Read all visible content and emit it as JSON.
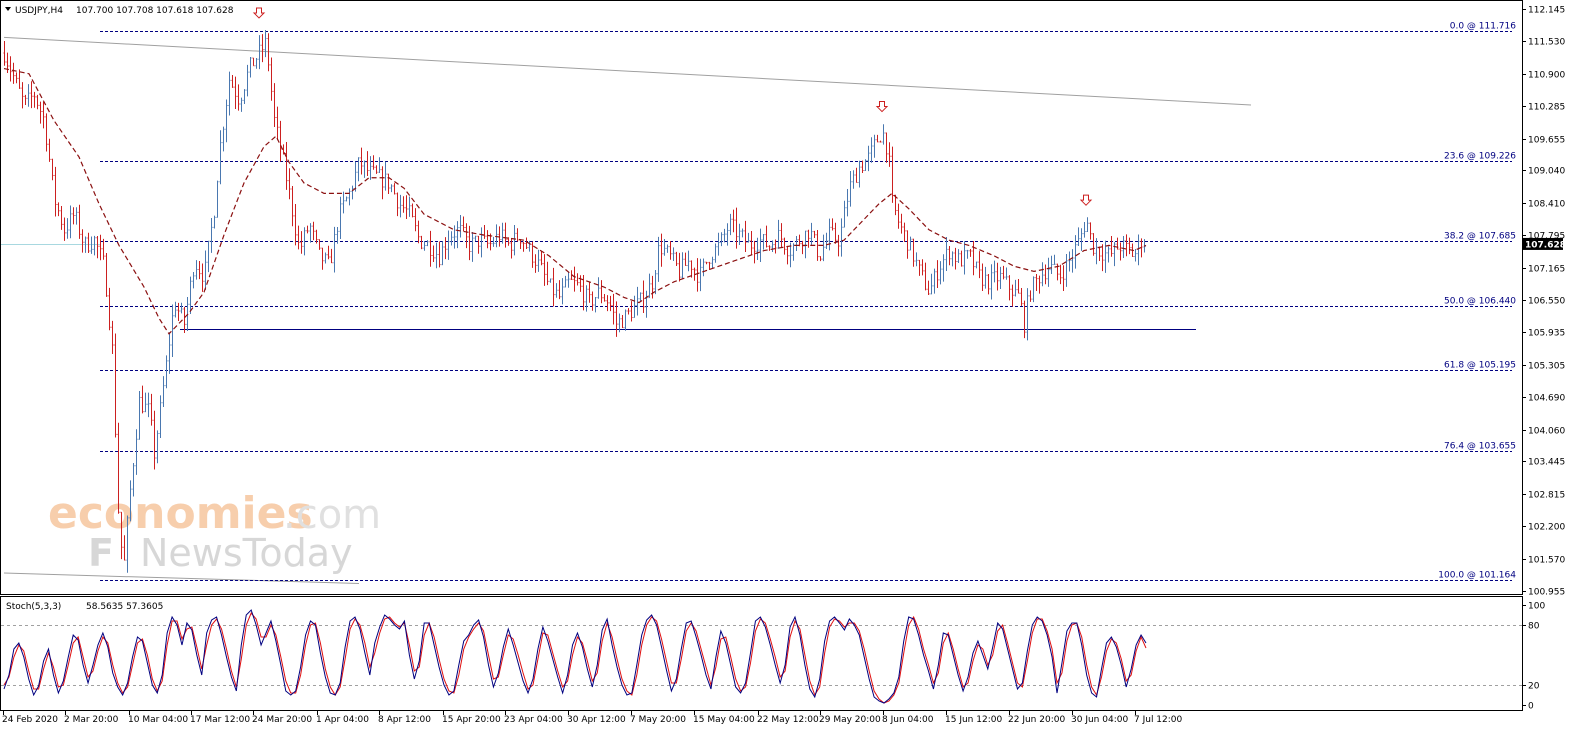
{
  "header": {
    "symbol_label": "USDJPY,H4",
    "ohlc_label": "107.700 107.708 107.618 107.628"
  },
  "sub_window": {
    "label": "Stoch(5,3,3)",
    "values_label": "58.5635 57.3605"
  },
  "watermark": {
    "line1_a": "economies",
    "line1_b": ".com",
    "line2_a": "F",
    "line2_b": "NewsToday"
  },
  "colors": {
    "bull": "#4a78b0",
    "bear": "#cc2020",
    "ma": "#8b1010",
    "fib": "#000080",
    "stoch_main": "#000080",
    "stoch_signal": "#e01010",
    "trend": "#a0a0a0",
    "current_price_box": "#000000"
  },
  "chart_data": [
    {
      "type": "candlestick",
      "title": "USDJPY,H4",
      "ylim": [
        100.955,
        112.145
      ],
      "y_ticks": [
        "112.145",
        "111.530",
        "110.900",
        "110.285",
        "109.655",
        "109.040",
        "108.410",
        "107.795",
        "107.165",
        "106.550",
        "105.935",
        "105.305",
        "104.690",
        "104.060",
        "103.445",
        "102.815",
        "102.200",
        "101.570",
        "100.955"
      ],
      "x_ticks": [
        "24 Feb 2020",
        "2 Mar 20:00",
        "10 Mar 04:00",
        "17 Mar 12:00",
        "24 Mar 20:00",
        "1 Apr 04:00",
        "8 Apr 12:00",
        "15 Apr 20:00",
        "23 Apr 04:00",
        "30 Apr 12:00",
        "7 May 20:00",
        "15 May 04:00",
        "22 May 12:00",
        "29 May 20:00",
        "8 Jun 04:00",
        "15 Jun 12:00",
        "22 Jun 20:00",
        "30 Jun 04:00",
        "7 Jul 12:00"
      ],
      "current_price": "107.628",
      "fibonacci": [
        {
          "label": "0.0 @ 111.716",
          "value": 111.716
        },
        {
          "label": "23.6 @ 109.226",
          "value": 109.226
        },
        {
          "label": "38.2 @ 107.685",
          "value": 107.685
        },
        {
          "label": "50.0 @ 106.440",
          "value": 106.44
        },
        {
          "label": "61.8 @ 105.195",
          "value": 105.195
        },
        {
          "label": "76.4 @ 103.655",
          "value": 103.655
        },
        {
          "label": "100.0 @ 101.164",
          "value": 101.164
        }
      ],
      "support_level": 106.0,
      "price_path": [
        [
          0,
          111.3
        ],
        [
          10,
          110.8
        ],
        [
          20,
          110.3
        ],
        [
          30,
          110.5
        ],
        [
          40,
          110.0
        ],
        [
          50,
          108.5
        ],
        [
          60,
          107.9
        ],
        [
          70,
          108.2
        ],
        [
          80,
          107.6
        ],
        [
          90,
          107.7
        ],
        [
          100,
          107.2
        ],
        [
          108,
          105.6
        ],
        [
          115,
          102.0
        ],
        [
          120,
          101.5
        ],
        [
          125,
          102.7
        ],
        [
          135,
          104.6
        ],
        [
          145,
          104.4
        ],
        [
          150,
          103.6
        ],
        [
          160,
          105.0
        ],
        [
          170,
          106.5
        ],
        [
          180,
          106.1
        ],
        [
          190,
          107.3
        ],
        [
          200,
          107.0
        ],
        [
          210,
          108.3
        ],
        [
          215,
          109.4
        ],
        [
          225,
          110.8
        ],
        [
          235,
          110.4
        ],
        [
          245,
          111.0
        ],
        [
          255,
          111.3
        ],
        [
          262,
          111.5
        ],
        [
          270,
          110.0
        ],
        [
          278,
          109.3
        ],
        [
          285,
          108.6
        ],
        [
          295,
          107.5
        ],
        [
          305,
          108.0
        ],
        [
          315,
          107.4
        ],
        [
          325,
          107.2
        ],
        [
          335,
          108.2
        ],
        [
          345,
          108.6
        ],
        [
          355,
          109.2
        ],
        [
          365,
          109.0
        ],
        [
          375,
          108.9
        ],
        [
          385,
          108.8
        ],
        [
          395,
          108.4
        ],
        [
          405,
          108.2
        ],
        [
          415,
          107.7
        ],
        [
          425,
          107.6
        ],
        [
          435,
          107.4
        ],
        [
          445,
          107.8
        ],
        [
          455,
          107.9
        ],
        [
          465,
          107.6
        ],
        [
          475,
          107.7
        ],
        [
          485,
          107.6
        ],
        [
          495,
          107.8
        ],
        [
          505,
          107.6
        ],
        [
          515,
          107.8
        ],
        [
          525,
          107.5
        ],
        [
          535,
          107.2
        ],
        [
          545,
          106.8
        ],
        [
          555,
          106.6
        ],
        [
          565,
          106.9
        ],
        [
          575,
          106.8
        ],
        [
          585,
          106.5
        ],
        [
          595,
          106.7
        ],
        [
          605,
          106.5
        ],
        [
          612,
          106.1
        ],
        [
          620,
          106.2
        ],
        [
          630,
          106.4
        ],
        [
          640,
          106.6
        ],
        [
          648,
          106.9
        ],
        [
          655,
          107.6
        ],
        [
          665,
          107.4
        ],
        [
          675,
          107.1
        ],
        [
          685,
          107.3
        ],
        [
          695,
          107.0
        ],
        [
          705,
          107.4
        ],
        [
          715,
          107.6
        ],
        [
          725,
          108.0
        ],
        [
          735,
          107.8
        ],
        [
          745,
          107.6
        ],
        [
          755,
          107.7
        ],
        [
          765,
          107.6
        ],
        [
          775,
          107.8
        ],
        [
          785,
          107.5
        ],
        [
          795,
          107.7
        ],
        [
          805,
          107.9
        ],
        [
          815,
          107.4
        ],
        [
          825,
          107.8
        ],
        [
          835,
          107.7
        ],
        [
          845,
          108.7
        ],
        [
          855,
          109.1
        ],
        [
          865,
          109.3
        ],
        [
          872,
          109.6
        ],
        [
          878,
          109.8
        ],
        [
          884,
          109.4
        ],
        [
          888,
          108.4
        ],
        [
          895,
          108.0
        ],
        [
          905,
          107.6
        ],
        [
          915,
          107.1
        ],
        [
          925,
          106.7
        ],
        [
          935,
          107.2
        ],
        [
          945,
          107.5
        ],
        [
          955,
          107.3
        ],
        [
          965,
          107.4
        ],
        [
          975,
          107.0
        ],
        [
          985,
          106.9
        ],
        [
          995,
          107.0
        ],
        [
          1005,
          106.8
        ],
        [
          1015,
          106.6
        ],
        [
          1020,
          106.1
        ],
        [
          1025,
          106.7
        ],
        [
          1035,
          107.0
        ],
        [
          1045,
          107.2
        ],
        [
          1055,
          107.0
        ],
        [
          1065,
          107.3
        ],
        [
          1075,
          107.7
        ],
        [
          1082,
          108.1
        ],
        [
          1088,
          107.6
        ],
        [
          1095,
          107.5
        ],
        [
          1105,
          107.4
        ],
        [
          1115,
          107.6
        ],
        [
          1125,
          107.5
        ],
        [
          1130,
          107.4
        ],
        [
          1137,
          107.7
        ],
        [
          1142,
          107.63
        ]
      ],
      "ma_path": [
        [
          0,
          111.0
        ],
        [
          25,
          110.9
        ],
        [
          50,
          110.0
        ],
        [
          75,
          109.3
        ],
        [
          95,
          108.4
        ],
        [
          115,
          107.6
        ],
        [
          140,
          106.8
        ],
        [
          155,
          106.2
        ],
        [
          165,
          105.9
        ],
        [
          185,
          106.3
        ],
        [
          200,
          106.7
        ],
        [
          220,
          107.8
        ],
        [
          240,
          108.8
        ],
        [
          260,
          109.5
        ],
        [
          272,
          109.7
        ],
        [
          285,
          109.2
        ],
        [
          300,
          108.8
        ],
        [
          320,
          108.6
        ],
        [
          345,
          108.6
        ],
        [
          365,
          108.9
        ],
        [
          385,
          108.9
        ],
        [
          400,
          108.7
        ],
        [
          420,
          108.2
        ],
        [
          450,
          107.9
        ],
        [
          480,
          107.8
        ],
        [
          520,
          107.7
        ],
        [
          545,
          107.4
        ],
        [
          570,
          107.0
        ],
        [
          600,
          106.8
        ],
        [
          620,
          106.6
        ],
        [
          635,
          106.5
        ],
        [
          650,
          106.7
        ],
        [
          670,
          106.9
        ],
        [
          700,
          107.1
        ],
        [
          730,
          107.3
        ],
        [
          760,
          107.5
        ],
        [
          790,
          107.6
        ],
        [
          820,
          107.6
        ],
        [
          840,
          107.7
        ],
        [
          860,
          108.1
        ],
        [
          875,
          108.4
        ],
        [
          888,
          108.6
        ],
        [
          905,
          108.3
        ],
        [
          925,
          107.9
        ],
        [
          945,
          107.7
        ],
        [
          965,
          107.6
        ],
        [
          990,
          107.4
        ],
        [
          1010,
          107.2
        ],
        [
          1030,
          107.1
        ],
        [
          1055,
          107.2
        ],
        [
          1080,
          107.5
        ],
        [
          1105,
          107.6
        ],
        [
          1130,
          107.5
        ],
        [
          1142,
          107.6
        ]
      ],
      "resistance_trendline": [
        [
          0,
          111.6
        ],
        [
          1247,
          110.3
        ]
      ],
      "support_trendline": [
        [
          0,
          101.3
        ],
        [
          355,
          101.1
        ]
      ],
      "peak_markers": [
        [
          255,
          112.05
        ],
        [
          878,
          110.25
        ],
        [
          1082,
          108.45
        ]
      ]
    },
    {
      "type": "line",
      "title": "Stoch(5,3,3)",
      "ylim": [
        0,
        100
      ],
      "y_ticks": [
        "100",
        "80",
        "20",
        "0"
      ],
      "levels": [
        80,
        20
      ],
      "main_last": 58.5635,
      "signal_last": 57.3605,
      "series": [
        {
          "values": [
            16,
            30,
            56,
            62,
            48,
            26,
            10,
            19,
            44,
            56,
            30,
            12,
            24,
            48,
            70,
            65,
            40,
            22,
            40,
            60,
            72,
            58,
            32,
            18,
            10,
            22,
            48,
            68,
            64,
            42,
            20,
            12,
            30,
            72,
            88,
            80,
            60,
            82,
            75,
            50,
            30,
            72,
            85,
            88,
            70,
            48,
            28,
            14,
            60,
            90,
            95,
            80,
            60,
            72,
            84,
            64,
            40,
            14,
            10,
            14,
            38,
            70,
            84,
            80,
            52,
            28,
            12,
            10,
            22,
            58,
            84,
            88,
            76,
            52,
            30,
            62,
            78,
            90,
            86,
            80,
            76,
            84,
            50,
            26,
            44,
            82,
            82,
            60,
            38,
            20,
            10,
            14,
            40,
            64,
            70,
            80,
            85,
            68,
            40,
            18,
            32,
            58,
            76,
            60,
            42,
            24,
            12,
            26,
            56,
            78,
            64,
            46,
            28,
            12,
            30,
            60,
            72,
            58,
            36,
            18,
            40,
            75,
            86,
            60,
            38,
            20,
            10,
            12,
            40,
            70,
            85,
            90,
            80,
            58,
            35,
            14,
            26,
            56,
            82,
            84,
            68,
            50,
            30,
            16,
            48,
            74,
            62,
            40,
            18,
            12,
            22,
            52,
            84,
            88,
            78,
            60,
            40,
            22,
            40,
            78,
            88,
            70,
            40,
            16,
            8,
            26,
            64,
            84,
            88,
            82,
            75,
            86,
            80,
            70,
            48,
            26,
            8,
            4,
            2,
            6,
            12,
            28,
            64,
            88,
            86,
            70,
            50,
            34,
            16,
            40,
            72,
            70,
            50,
            30,
            14,
            28,
            52,
            64,
            50,
            36,
            58,
            82,
            76,
            56,
            36,
            16,
            22,
            54,
            80,
            88,
            84,
            70,
            48,
            12,
            42,
            74,
            82,
            82,
            60,
            30,
            12,
            8,
            36,
            62,
            68,
            58,
            40,
            18,
            36,
            60,
            70,
            62
          ]
        },
        {
          "values": [
            20,
            28,
            48,
            60,
            54,
            34,
            16,
            16,
            36,
            52,
            38,
            18,
            20,
            40,
            62,
            68,
            48,
            28,
            34,
            54,
            68,
            62,
            40,
            22,
            12,
            18,
            40,
            62,
            66,
            50,
            26,
            14,
            24,
            60,
            84,
            84,
            66,
            76,
            78,
            58,
            36,
            60,
            80,
            86,
            76,
            56,
            34,
            18,
            46,
            80,
            92,
            86,
            68,
            68,
            80,
            70,
            48,
            24,
            12,
            12,
            30,
            60,
            80,
            82,
            62,
            36,
            18,
            10,
            18,
            46,
            76,
            86,
            80,
            62,
            38,
            52,
            72,
            86,
            88,
            82,
            78,
            82,
            60,
            34,
            38,
            70,
            82,
            68,
            46,
            26,
            14,
            12,
            30,
            56,
            68,
            76,
            82,
            74,
            50,
            26,
            28,
            50,
            70,
            66,
            50,
            32,
            16,
            20,
            46,
            72,
            70,
            52,
            34,
            18,
            24,
            50,
            68,
            62,
            44,
            24,
            32,
            64,
            82,
            68,
            46,
            26,
            14,
            10,
            30,
            60,
            80,
            88,
            84,
            66,
            44,
            22,
            22,
            46,
            74,
            82,
            74,
            56,
            38,
            20,
            38,
            66,
            68,
            48,
            26,
            14,
            18,
            42,
            74,
            86,
            82,
            66,
            48,
            28,
            34,
            68,
            84,
            76,
            50,
            24,
            10,
            18,
            52,
            78,
            86,
            84,
            78,
            82,
            82,
            74,
            56,
            34,
            14,
            6,
            2,
            4,
            10,
            22,
            52,
            80,
            88,
            76,
            56,
            40,
            22,
            32,
            62,
            72,
            56,
            36,
            18,
            22,
            44,
            60,
            56,
            40,
            50,
            74,
            80,
            62,
            42,
            22,
            18,
            44,
            72,
            86,
            86,
            74,
            56,
            22,
            32,
            64,
            80,
            82,
            68,
            40,
            18,
            10,
            28,
            54,
            66,
            62,
            46,
            24,
            30,
            54,
            68,
            57
          ]
        }
      ]
    }
  ]
}
